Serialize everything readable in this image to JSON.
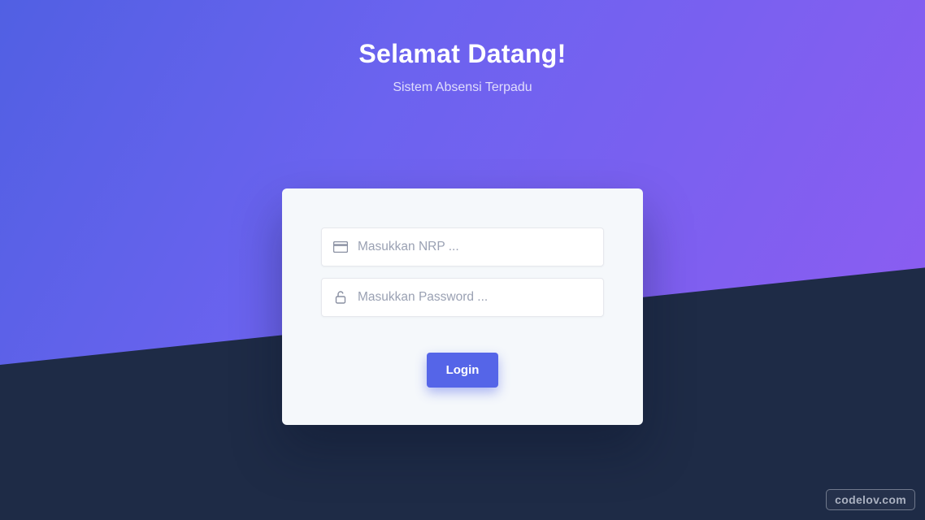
{
  "hero": {
    "title": "Selamat Datang!",
    "subtitle": "Sistem Absensi Terpadu"
  },
  "form": {
    "nrp": {
      "value": "",
      "placeholder": "Masukkan NRP ..."
    },
    "password": {
      "value": "",
      "placeholder": "Masukkan Password ..."
    },
    "login_label": "Login"
  },
  "watermark": "codelov.com",
  "colors": {
    "gradient_from": "#4b5fe0",
    "gradient_to": "#8a5df1",
    "dark_bg": "#1e2b46",
    "card_bg": "#f5f8fb",
    "primary": "#5565e8"
  }
}
